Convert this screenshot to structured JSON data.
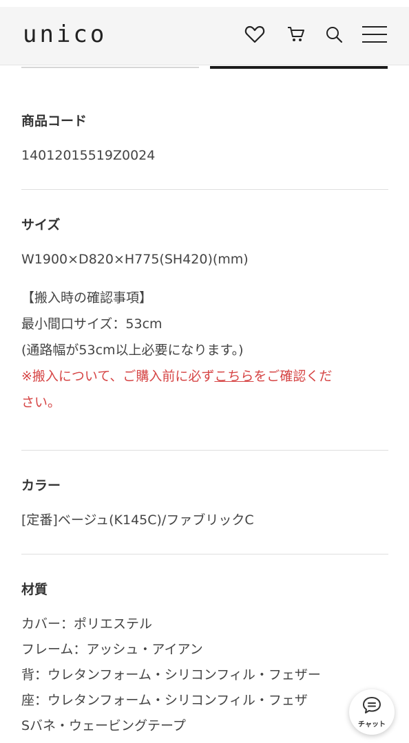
{
  "header": {
    "logo": "unico",
    "icons": [
      "heart-icon",
      "cart-icon",
      "search-icon",
      "menu-icon"
    ]
  },
  "product_code": {
    "title": "商品コード",
    "value": "14012015519Z0024"
  },
  "size": {
    "title": "サイズ",
    "value": "W1900×D820×H775(SH420)(mm)",
    "note_heading": "【搬入時の確認事項】",
    "note_min": "最小間口サイズ：53cm",
    "note_paren": "(通路幅が53cm以上必要になります。)",
    "warn_prefix": "※搬入について、ご購入前に必ず",
    "warn_link": "こちら",
    "warn_suffix_1": "をご確認くだ",
    "warn_suffix_2": "さい。"
  },
  "color": {
    "title": "カラー",
    "value": "[定番]ベージュ(K145C)/ファブリックC"
  },
  "material": {
    "title": "材質",
    "lines": [
      "カバー：ポリエステル",
      "フレーム：アッシュ・アイアン",
      "背：ウレタンフォーム・シリコンフィル・フェザー",
      "座：ウレタンフォーム・シリコンフィル・フェザ",
      "Sバネ・ウェービングテープ"
    ]
  },
  "chat": {
    "label": "チャット"
  },
  "colors": {
    "warning": "#d64545",
    "active_tab": "#1b1b1b",
    "header_bg": "#f5f5f5"
  }
}
